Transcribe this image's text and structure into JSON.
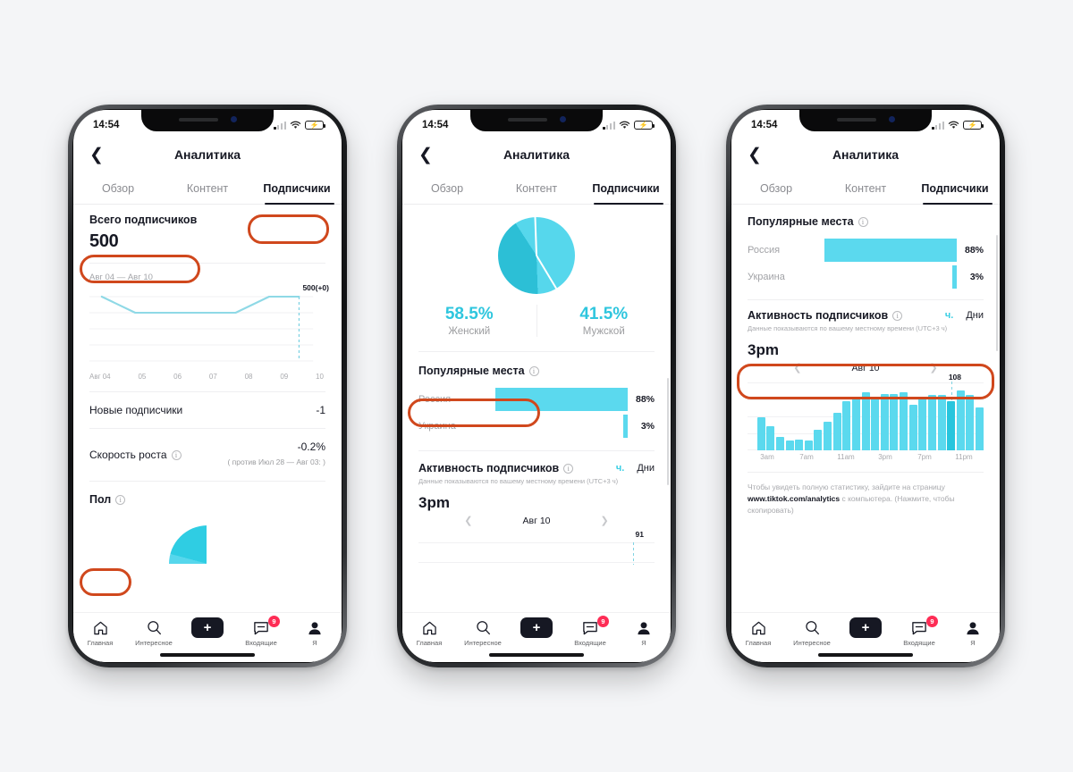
{
  "meta": {
    "accent_cyan": "#5bd9ee",
    "accent_cyan_dark": "#27c5dd",
    "highlight_orange": "#d0481d",
    "ink": "#161823"
  },
  "status_bar": {
    "time": "14:54",
    "signal_icon": "cellular-signal-icon",
    "wifi_icon": "wifi-icon",
    "battery_icon": "battery-charging-icon"
  },
  "header": {
    "back_icon": "back-chevron-icon",
    "title": "Аналитика"
  },
  "tabs": [
    {
      "id": "overview",
      "label": "Обзор",
      "active": false
    },
    {
      "id": "content",
      "label": "Контент",
      "active": false
    },
    {
      "id": "followers",
      "label": "Подписчики",
      "active": true
    }
  ],
  "bottom_nav": [
    {
      "id": "home",
      "label": "Главная",
      "icon": "home-icon"
    },
    {
      "id": "discover",
      "label": "Интересное",
      "icon": "search-icon"
    },
    {
      "id": "create",
      "label": "",
      "icon": "plus-create-icon"
    },
    {
      "id": "inbox",
      "label": "Входящие",
      "icon": "message-icon",
      "badge": "9"
    },
    {
      "id": "profile",
      "label": "Я",
      "icon": "person-icon"
    }
  ],
  "phone1": {
    "total_followers": {
      "label": "Всего подписчиков",
      "value": "500"
    },
    "date_range": "Авг 04 — Авг 10",
    "new_followers": {
      "label": "Новые подписчики",
      "value": "-1"
    },
    "growth_rate": {
      "label": "Скорость роста",
      "value": "-0.2%",
      "sub": "( против Июл 28 — Авг 03: )"
    },
    "gender_section": {
      "label": "Пол"
    },
    "highlights": [
      "Подписчики",
      "Всего подписчиков",
      "Пол"
    ]
  },
  "phone2": {
    "gender": [
      {
        "label": "Женский",
        "pct": "58.5%"
      },
      {
        "label": "Мужской",
        "pct": "41.5%"
      }
    ],
    "geo_title": "Популярные места",
    "activity_title": "Активность подписчиков",
    "activity_note": "Данные показываются по вашему местному времени (UTC+3 ч)",
    "segments": {
      "hours": "ч.",
      "days": "Дни"
    },
    "peak_hour": "3pm",
    "day_label": "Авг 10",
    "peak_value": "91",
    "highlights": [
      "Популярные места"
    ]
  },
  "phone3": {
    "geo_title": "Популярные места",
    "activity_title": "Активность подписчиков",
    "activity_note": "Данные показываются по вашему местному времени (UTC+3 ч)",
    "segments": {
      "hours": "ч.",
      "days": "Дни"
    },
    "peak_hour": "3pm",
    "day_label": "Авг 10",
    "peak_value": "108",
    "footnote_lead": "Чтобы увидеть полную статистику, зайдите на страницу",
    "footnote_link": "www.tiktok.com/analytics",
    "footnote_tail": " с компьютера. (Нажмите, чтобы скопировать)",
    "highlights": [
      "Активность подписчиков"
    ]
  },
  "chart_data": [
    {
      "id": "followers-trend",
      "type": "line",
      "title": "Всего подписчиков",
      "x": [
        "Авг 04",
        "05",
        "06",
        "07",
        "08",
        "09",
        "10"
      ],
      "values": [
        500,
        499,
        499,
        499,
        499,
        500,
        500
      ],
      "annotation": "500(+0)",
      "ylim": [
        497,
        501
      ],
      "grid": true,
      "legend": "none"
    },
    {
      "id": "gender-pie",
      "type": "pie",
      "title": "Пол",
      "categories": [
        "Женский",
        "Мужской"
      ],
      "values": [
        58.5,
        41.5
      ],
      "colors": [
        "#56d7ec",
        "#2cbfd6"
      ],
      "legend": "below"
    },
    {
      "id": "top-locations",
      "type": "bar",
      "title": "Популярные места",
      "orientation": "horizontal",
      "categories": [
        "Россия",
        "Украина"
      ],
      "values": [
        88,
        3
      ],
      "value_labels": [
        "88%",
        "3%"
      ],
      "xlabel": "",
      "ylabel": "",
      "xlim": [
        0,
        100
      ]
    },
    {
      "id": "follower-activity-phone2",
      "type": "bar",
      "title": "Активность подписчиков",
      "subtitle": "Авг 10",
      "peak_label": "91",
      "categories": [
        "3am",
        "7am",
        "11am",
        "3pm",
        "7pm",
        "11pm"
      ],
      "values": [],
      "note": "Данные показываются по вашему местному времени (UTC+3 ч)"
    },
    {
      "id": "follower-activity-phone3",
      "type": "bar",
      "title": "Активность подписчиков",
      "subtitle": "Авг 10",
      "peak_label": "108",
      "peak_index": 21,
      "categories": [
        "12am",
        "1am",
        "2am",
        "3am",
        "4am",
        "5am",
        "6am",
        "7am",
        "8am",
        "9am",
        "10am",
        "11am",
        "12pm",
        "1pm",
        "2pm",
        "3pm",
        "4pm",
        "5pm",
        "6pm",
        "7pm",
        "8pm",
        "9pm",
        "10pm",
        "11pm"
      ],
      "tick_labels": [
        "3am",
        "7am",
        "11am",
        "3pm",
        "7pm",
        "11pm"
      ],
      "values": [
        0,
        52,
        38,
        22,
        15,
        17,
        15,
        32,
        45,
        60,
        78,
        85,
        92,
        84,
        90,
        90,
        93,
        72,
        84,
        88,
        88,
        78,
        95,
        88,
        68
      ],
      "ylim": [
        0,
        108
      ],
      "grid": true,
      "note": "Данные показываются по вашему местному времени (UTC+3 ч)"
    }
  ]
}
